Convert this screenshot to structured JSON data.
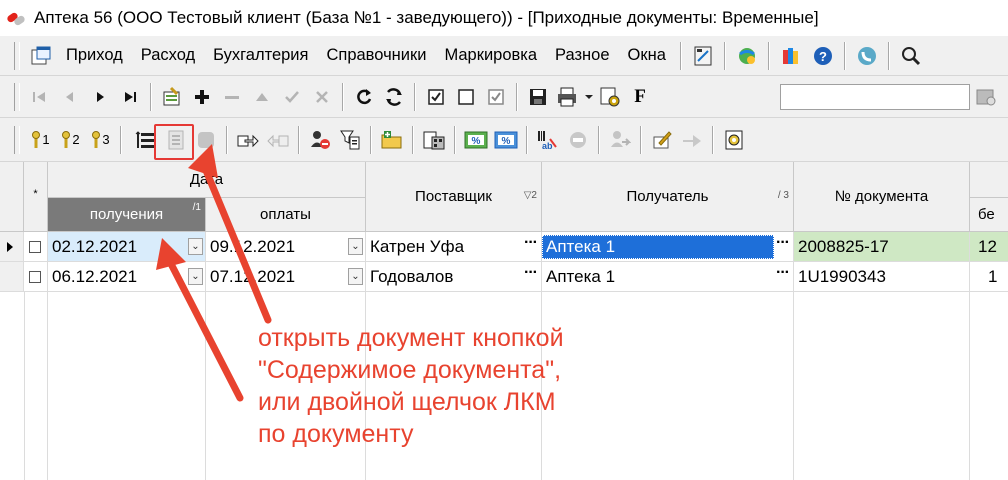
{
  "window": {
    "title": "Аптека 56 (ООО Тестовый клиент (База №1 - заведующего)) - [Приходные документы: Временные]"
  },
  "menu": {
    "items": [
      "Приход",
      "Расход",
      "Бухгалтерия",
      "Справочники",
      "Маркировка",
      "Разное",
      "Окна"
    ]
  },
  "toolbar": {
    "filter_labels": [
      "1",
      "2",
      "3"
    ],
    "format_label": "F"
  },
  "grid": {
    "headers": {
      "date_group": "Дата",
      "received": "получения",
      "received_sort": "/1",
      "payment": "оплаты",
      "supplier": "Поставщик",
      "supplier_sort": "▽2",
      "recipient": "Получатель",
      "recipient_sort": "/ 3",
      "doc_number": "№ документа",
      "extra": "бе",
      "marker": "*"
    },
    "rows": [
      {
        "received": "02.12.2021",
        "payment": "09.12.2021",
        "supplier": "Катрен Уфа",
        "recipient": "Аптека 1",
        "doc_number": "2008825-17",
        "extra": "12"
      },
      {
        "received": "06.12.2021",
        "payment": "07.12.2021",
        "supplier": "Годовалов",
        "recipient": "Аптека 1",
        "doc_number": "1U1990343",
        "extra": "1"
      }
    ]
  },
  "annotation": {
    "lines": [
      "открыть документ кнопкой",
      "\"Содержимое документа\",",
      "или двойной щелчок ЛКМ",
      "по документу"
    ],
    "color": "#e8432f"
  },
  "colors": {
    "selection_blue": "#1e6fd9",
    "selection_green": "#cfe8c4",
    "sorted_header": "#7a7a7a"
  }
}
